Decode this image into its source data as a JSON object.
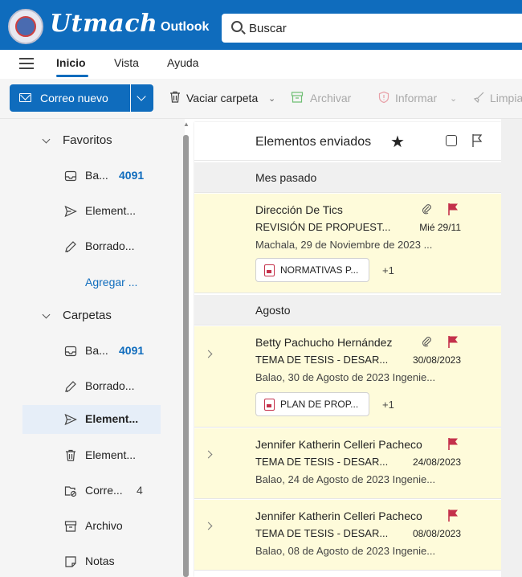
{
  "header": {
    "brand": "Utmach",
    "app_title": "Outlook",
    "search_placeholder": "Buscar"
  },
  "menu": {
    "items": [
      "Inicio",
      "Vista",
      "Ayuda"
    ],
    "active": "Inicio"
  },
  "toolbar": {
    "new_mail_label": "Correo nuevo",
    "empty_folder": "Vaciar carpeta",
    "archive": "Archivar",
    "report": "Informar",
    "clean": "Limpia"
  },
  "nav": {
    "favorites_label": "Favoritos",
    "favorites": [
      {
        "label": "Ba...",
        "count": "4091",
        "icon": "inbox-icon"
      },
      {
        "label": "Element...",
        "icon": "send-icon"
      },
      {
        "label": "Borrado...",
        "icon": "pencil-icon"
      }
    ],
    "add_link": "Agregar ...",
    "folders_label": "Carpetas",
    "folders": [
      {
        "label": "Ba...",
        "count": "4091",
        "icon": "inbox-icon"
      },
      {
        "label": "Borrado...",
        "icon": "pencil-icon"
      },
      {
        "label": "Element...",
        "icon": "send-icon",
        "active": true
      },
      {
        "label": "Element...",
        "icon": "trash-icon"
      },
      {
        "label": "Corre...",
        "count": "4",
        "icon": "junk-folder-icon"
      },
      {
        "label": "Archivo",
        "icon": "archive-icon"
      },
      {
        "label": "Notas",
        "icon": "note-icon"
      }
    ]
  },
  "list": {
    "title": "Elementos enviados",
    "groups": [
      {
        "label": "Mes pasado",
        "messages": [
          {
            "sender": "Dirección De Tics",
            "subject": "REVISIÓN DE PROPUEST...",
            "date": "Mié 29/11",
            "preview": "Machala, 29 de Noviembre de 2023 ...",
            "attachment": "NORMATIVAS P...",
            "extra": "+1"
          }
        ]
      },
      {
        "label": "Agosto",
        "messages": [
          {
            "sender": "Betty Pachucho Hernández",
            "subject": "TEMA DE TESIS - DESAR...",
            "date": "30/08/2023",
            "preview": "Balao, 30 de Agosto de 2023 Ingenie...",
            "attachment": "PLAN DE PROP...",
            "extra": "+1"
          },
          {
            "sender": "Jennifer Katherin Celleri Pacheco",
            "subject": "TEMA DE TESIS - DESAR...",
            "date": "24/08/2023",
            "preview": "Balao, 24 de Agosto de 2023 Ingenie..."
          },
          {
            "sender": "Jennifer Katherin Celleri Pacheco",
            "subject": "TEMA DE TESIS - DESAR...",
            "date": "08/08/2023",
            "preview": "Balao, 08 de Agosto de 2023 Ingenie..."
          }
        ]
      }
    ]
  },
  "colors": {
    "accent": "#0f6cbd",
    "flag": "#c4314b",
    "flagged_bg": "#fefbda"
  }
}
